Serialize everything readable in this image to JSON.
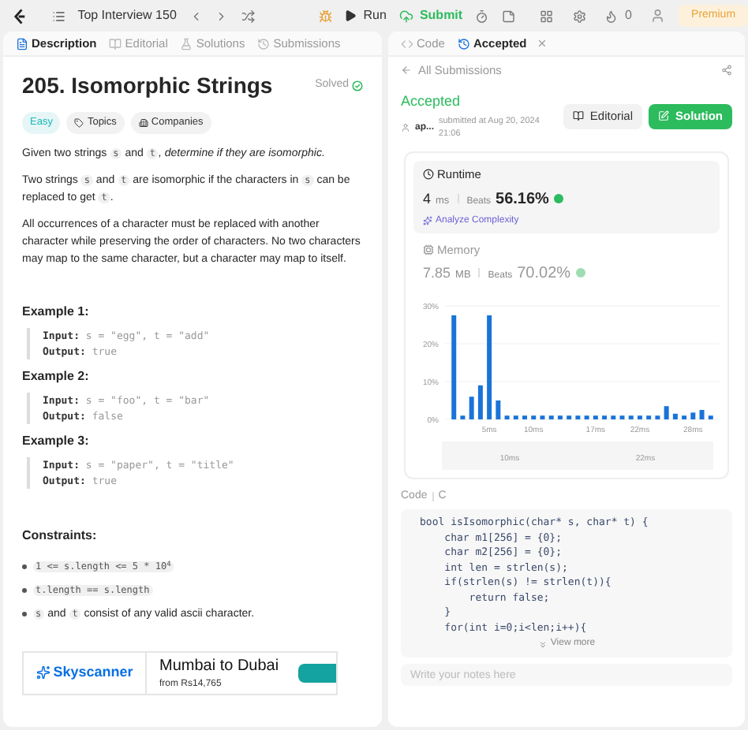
{
  "topbar": {
    "list_title": "Top Interview 150",
    "run": "Run",
    "submit": "Submit",
    "streak": "0",
    "premium": "Premium"
  },
  "left_tabs": [
    {
      "label": "Description",
      "selected": true
    },
    {
      "label": "Editorial",
      "selected": false
    },
    {
      "label": "Solutions",
      "selected": false
    },
    {
      "label": "Submissions",
      "selected": false
    }
  ],
  "right_tabs": [
    {
      "label": "Code",
      "selected": false,
      "closable": false
    },
    {
      "label": "Accepted",
      "selected": true,
      "closable": true
    }
  ],
  "problem": {
    "title": "205. Isomorphic Strings",
    "status": "Solved",
    "difficulty": "Easy",
    "tags": [
      "Topics",
      "Companies"
    ],
    "paragraphs": [
      [
        {
          "kind": "text",
          "text": "Given two strings "
        },
        {
          "kind": "code",
          "text": "s"
        },
        {
          "kind": "text",
          "text": " and "
        },
        {
          "kind": "code",
          "text": "t"
        },
        {
          "kind": "italic",
          "text": ", determine if they are isomorphic."
        }
      ],
      [
        {
          "kind": "text",
          "text": "Two strings "
        },
        {
          "kind": "code",
          "text": "s"
        },
        {
          "kind": "text",
          "text": " and "
        },
        {
          "kind": "code",
          "text": "t"
        },
        {
          "kind": "text",
          "text": " are isomorphic if the characters in "
        },
        {
          "kind": "code",
          "text": "s"
        },
        {
          "kind": "text",
          "text": " can be replaced to get "
        },
        {
          "kind": "code",
          "text": "t"
        },
        {
          "kind": "text",
          "text": "."
        }
      ],
      [
        {
          "kind": "text",
          "text": "All occurrences of a character must be replaced with another character while preserving the order of characters. No two characters may map to the same character, but a character may map to itself."
        }
      ]
    ],
    "examples": [
      {
        "title": "Example 1:",
        "input_label": "Input:",
        "input": "s = \"egg\", t = \"add\"",
        "output_label": "Output:",
        "output": "true"
      },
      {
        "title": "Example 2:",
        "input_label": "Input:",
        "input": "s = \"foo\", t = \"bar\"",
        "output_label": "Output:",
        "output": "false"
      },
      {
        "title": "Example 3:",
        "input_label": "Input:",
        "input": "s = \"paper\", t = \"title\"",
        "output_label": "Output:",
        "output": "true"
      }
    ],
    "constraints_title": "Constraints:",
    "constraints": [
      [
        {
          "kind": "code",
          "text": "1 <= s.length <= 5 * 10$^{4}$"
        }
      ],
      [
        {
          "kind": "code",
          "text": "t.length == s.length"
        }
      ],
      [
        {
          "kind": "code",
          "text": "s"
        },
        {
          "kind": "text",
          "text": " and "
        },
        {
          "kind": "code",
          "text": "t"
        },
        {
          "kind": "text",
          "text": " consist of any valid ascii character."
        }
      ]
    ],
    "ad": {
      "brand": "Skyscanner",
      "headline": "Mumbai to Dubai",
      "price": "from Rs14,765"
    }
  },
  "submission": {
    "back": "All Submissions",
    "status": "Accepted",
    "user": "ap...",
    "submitted": "submitted at Aug 20, 2024 21:06",
    "editorial": "Editorial",
    "solution": "Solution",
    "metrics": [
      {
        "label": "Runtime",
        "value": "4",
        "unit": "ms",
        "beats_label": "Beats",
        "beats": "56.16%",
        "selected": true,
        "link": "Analyze Complexity"
      },
      {
        "label": "Memory",
        "value": "7.85",
        "unit": "MB",
        "beats_label": "Beats",
        "beats": "70.02%",
        "selected": false
      }
    ],
    "chart_data": {
      "type": "bar",
      "ylim": [
        0,
        30
      ],
      "yticks": [
        {
          "value": 0,
          "label": "0%"
        },
        {
          "value": 10,
          "label": "10%"
        },
        {
          "value": 20,
          "label": "20%"
        },
        {
          "value": 30,
          "label": "30%"
        }
      ],
      "x": [
        1,
        2,
        3,
        4,
        5,
        6,
        7,
        8,
        9,
        10,
        11,
        12,
        13,
        14,
        15,
        16,
        17,
        18,
        19,
        20,
        21,
        22,
        23,
        24,
        25,
        26,
        27,
        28,
        29,
        30
      ],
      "xlim": [
        0,
        31
      ],
      "xticks": [
        {
          "value": 5,
          "label": "5ms"
        },
        {
          "value": 10,
          "label": "10ms"
        },
        {
          "value": 17,
          "label": "17ms"
        },
        {
          "value": 22,
          "label": "22ms"
        },
        {
          "value": 28,
          "label": "28ms"
        }
      ],
      "series": [
        {
          "color": "#1a73d9",
          "values": [
            27.5,
            1,
            6,
            9,
            27.5,
            5,
            1,
            1,
            1,
            1,
            1,
            1,
            1,
            1,
            1,
            1,
            1,
            1,
            1,
            1,
            1,
            1,
            1,
            1,
            3.5,
            1.5,
            1,
            1.8,
            2.5,
            1
          ]
        }
      ]
    },
    "brush_labels": [
      "10ms",
      "22ms"
    ],
    "code_header": [
      "Code",
      "C"
    ],
    "code": [
      "bool isIsomorphic(char* s, char* t) {",
      "    char m1[256] = {0};",
      "    char m2[256] = {0};",
      "    int len = strlen(s);",
      "    if(strlen(s) != strlen(t)){",
      "        return false;",
      "    }",
      "    for(int i=0;i<len;i++){"
    ],
    "view_more": "View more",
    "notes_placeholder": "Write your notes here"
  }
}
